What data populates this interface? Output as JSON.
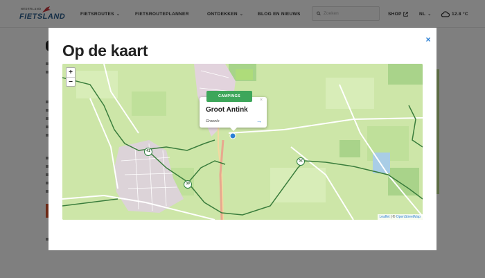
{
  "header": {
    "logo_top": "NEDERLAND",
    "logo_main": "FIETSLAND",
    "nav": [
      {
        "label": "FIETSROUTES",
        "has_dropdown": true
      },
      {
        "label": "FIETSROUTEPLANNER",
        "has_dropdown": false
      },
      {
        "label": "ONTDEKKEN",
        "has_dropdown": true
      },
      {
        "label": "BLOG EN NIEUWS",
        "has_dropdown": false
      }
    ],
    "search_placeholder": "Zoeken",
    "shop_label": "SHOP",
    "language": "NL",
    "weather": "12.8 °C"
  },
  "modal": {
    "title": "Op de kaart",
    "close_symbol": "×",
    "map": {
      "zoom_in": "+",
      "zoom_out": "−",
      "attribution_leaflet": "Leaflet",
      "attribution_sep": " | © ",
      "attribution_osm": "OpenStreetMap",
      "route_numbers": [
        "41",
        "39",
        "52"
      ],
      "popup": {
        "category": "CAMPINGS",
        "title": "Groot Antink",
        "subtitle": "Groenlo",
        "close_symbol": "×",
        "arrow": "→"
      }
    }
  },
  "colors": {
    "accent_blue": "#2a7fd4",
    "route_green": "#2e8040",
    "badge_green": "#3da65a",
    "map_field": "#c8e3a4"
  }
}
